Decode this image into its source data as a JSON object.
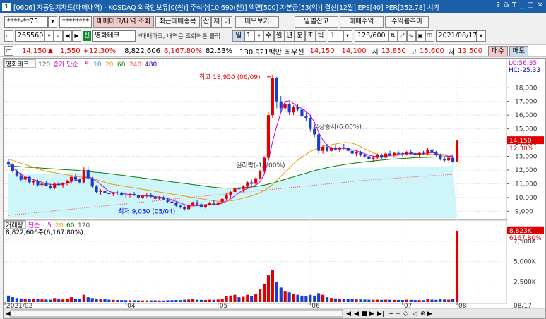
{
  "window": {
    "code": "[0606]",
    "title": "[0606] 자동일지차트(매매내역) - KOSDAQ 외국인보유[0(천)] 주식수[10,690(천)] 액면[500] 자본금[53(억)] 결산[12월] EPS[40] PER[352.78] 시가",
    "controls": [
      "?",
      "□",
      "⊡",
      "▲",
      "T",
      "?",
      "_",
      "□",
      "×"
    ]
  },
  "toolbar1": {
    "account": "****-**75",
    "password": "********",
    "btn_trade_mark": "매매마크/내역 조회",
    "btn_recent": "최근매매종목",
    "btn_balance_1": "잔",
    "btn_balance_2": "체",
    "btn_balance_3": "미",
    "btn_memo": "메모보기",
    "btn_daily": "일별잔고",
    "btn_profit": "매매수익",
    "btn_trend": "수익률추이"
  },
  "toolbar2": {
    "stock_code": "265560",
    "badge": "신",
    "stock_name": "영화테크",
    "hint": "*매매마크, 내역은 조회버튼 클릭",
    "period_buttons": [
      "일",
      "1",
      "주",
      "월",
      "년",
      "분",
      "초",
      "틱"
    ],
    "count_value": "1",
    "range": "123/600",
    "date": "2021/08/17"
  },
  "quote": {
    "price": "14,150",
    "change": "1,550",
    "change_pct": "+12.30%",
    "volume": "8,822,606",
    "volume_pct": "6,167.80%",
    "ratio": "82.53%",
    "amount": "130,921백만",
    "best_label": "최우선",
    "best_ask": "14,150",
    "best_bid": "14,100",
    "open_label": "시",
    "open": "13,850",
    "high_label": "고",
    "high": "15,600",
    "low_label": "저",
    "low": "13,500",
    "buy_btn": "매수",
    "sell_btn": "매도"
  },
  "price_panel": {
    "tab": "영화테크",
    "ma_header": "120",
    "ma_labels": [
      "종가 단순",
      "5",
      "10",
      "20",
      "60",
      "240",
      "480"
    ],
    "lc": "LC:56.35",
    "hc": "HC:-25.33",
    "annot_high": "최고 18,950 (06/09)",
    "annot_low": "최저 9,050 (05/04)",
    "annot_rights": "권리락(-15.00%)",
    "annot_bonus": "무상증자(6.00%)",
    "price_tag": "14,150",
    "pct_tag": "12.30%"
  },
  "volume_panel": {
    "label": "거래량",
    "ma_labels": [
      "단순",
      "5",
      "20",
      "60",
      "120"
    ],
    "value_text": "8,822,606주(6,167.80%)",
    "vol_tag": "8,823K",
    "pct_tag": "6167.80%",
    "date_end": "08/17"
  },
  "chart_data": {
    "type": "candlestick",
    "price_axis": [
      "18,000",
      "17,000",
      "16,000",
      "15,000",
      "14,000",
      "13,000",
      "12,000",
      "11,000",
      "10,000",
      "9,000"
    ],
    "price_range": [
      8500,
      19300
    ],
    "volume_axis": [
      "7,500K",
      "5,000K",
      "2,500K"
    ],
    "volume_range": [
      0,
      9500
    ],
    "x_labels": [
      "2021/02",
      "04",
      "05",
      "06",
      "07",
      "08"
    ],
    "candles": [
      [
        12600,
        12800,
        12200,
        12400,
        800
      ],
      [
        12400,
        12500,
        11800,
        11900,
        600
      ],
      [
        11900,
        12100,
        11500,
        11600,
        500
      ],
      [
        11600,
        11800,
        11200,
        11300,
        450
      ],
      [
        11300,
        11600,
        11100,
        11500,
        400
      ],
      [
        11500,
        11600,
        11000,
        11100,
        420
      ],
      [
        11100,
        11300,
        10900,
        11200,
        380
      ],
      [
        11200,
        11300,
        10800,
        10900,
        360
      ],
      [
        10900,
        11100,
        10700,
        11000,
        340
      ],
      [
        11000,
        11200,
        10800,
        10850,
        320
      ],
      [
        10850,
        11000,
        10600,
        10700,
        300
      ],
      [
        10700,
        11100,
        10600,
        11000,
        500
      ],
      [
        11000,
        11200,
        10800,
        10900,
        350
      ],
      [
        10900,
        11100,
        10700,
        11050,
        330
      ],
      [
        11050,
        11300,
        10900,
        11200,
        400
      ],
      [
        11200,
        11600,
        11000,
        11500,
        600
      ],
      [
        11500,
        11700,
        11200,
        11300,
        420
      ],
      [
        11300,
        11400,
        11000,
        11100,
        380
      ],
      [
        11100,
        12200,
        11000,
        12000,
        900
      ],
      [
        12000,
        12300,
        11300,
        11400,
        600
      ],
      [
        11400,
        11500,
        10700,
        10800,
        500
      ],
      [
        10800,
        10900,
        10300,
        10400,
        420
      ],
      [
        10400,
        10600,
        10200,
        10500,
        380
      ],
      [
        10500,
        10600,
        10200,
        10300,
        350
      ],
      [
        10300,
        10400,
        10100,
        10250,
        300
      ],
      [
        10250,
        10400,
        10100,
        10350,
        280
      ],
      [
        10350,
        10500,
        10200,
        10300,
        260
      ],
      [
        10300,
        10400,
        10100,
        10200,
        250
      ],
      [
        10200,
        10300,
        10000,
        10150,
        240
      ],
      [
        10150,
        10300,
        10000,
        10250,
        230
      ],
      [
        10250,
        10400,
        10100,
        10150,
        220
      ],
      [
        10150,
        10200,
        9900,
        10000,
        210
      ],
      [
        10000,
        10200,
        9900,
        10100,
        200
      ],
      [
        10100,
        10300,
        10000,
        10200,
        220
      ],
      [
        10200,
        10300,
        10000,
        10050,
        210
      ],
      [
        10050,
        10100,
        9800,
        9900,
        220
      ],
      [
        9900,
        10100,
        9800,
        10000,
        200
      ],
      [
        10000,
        10100,
        9800,
        9850,
        190
      ],
      [
        9850,
        9950,
        9600,
        9700,
        230
      ],
      [
        9700,
        9800,
        9500,
        9600,
        240
      ],
      [
        9600,
        9700,
        9300,
        9400,
        260
      ],
      [
        9400,
        9500,
        9200,
        9300,
        250
      ],
      [
        9300,
        9400,
        9050,
        9150,
        300
      ],
      [
        9150,
        9500,
        9100,
        9450,
        320
      ],
      [
        9450,
        9700,
        9350,
        9650,
        350
      ],
      [
        9650,
        9800,
        9400,
        9500,
        300
      ],
      [
        9500,
        9600,
        9250,
        9300,
        280
      ],
      [
        9300,
        9500,
        9200,
        9450,
        270
      ],
      [
        9450,
        9700,
        9400,
        9600,
        300
      ],
      [
        9600,
        9800,
        9450,
        9500,
        290
      ],
      [
        9500,
        9700,
        9400,
        9650,
        320
      ],
      [
        9650,
        10000,
        9600,
        9900,
        400
      ],
      [
        9900,
        10300,
        9800,
        10200,
        700
      ],
      [
        10200,
        10500,
        10000,
        10400,
        800
      ],
      [
        10400,
        10800,
        10300,
        10700,
        900
      ],
      [
        10700,
        11000,
        10500,
        10600,
        600
      ],
      [
        10600,
        10900,
        10400,
        10800,
        650
      ],
      [
        10800,
        11200,
        10700,
        11100,
        900
      ],
      [
        11100,
        11300,
        10900,
        11000,
        700
      ],
      [
        11000,
        11500,
        10900,
        11400,
        1000
      ],
      [
        11400,
        12000,
        11300,
        11900,
        1600
      ],
      [
        11900,
        13000,
        11800,
        12900,
        2200
      ],
      [
        12900,
        16200,
        12700,
        16000,
        3300
      ],
      [
        16000,
        18950,
        15800,
        18700,
        4000
      ],
      [
        18700,
        18800,
        16500,
        17000,
        2500
      ],
      [
        17000,
        17400,
        16200,
        16500,
        1800
      ],
      [
        16500,
        17000,
        16200,
        16800,
        1300
      ],
      [
        16800,
        16900,
        16000,
        16200,
        1200
      ],
      [
        16200,
        16700,
        16000,
        16600,
        1000
      ],
      [
        16600,
        16800,
        16300,
        16400,
        900
      ],
      [
        16400,
        16500,
        15800,
        15900,
        800
      ],
      [
        15900,
        16200,
        15600,
        15800,
        700
      ],
      [
        15800,
        16000,
        14800,
        15000,
        900
      ],
      [
        15000,
        15300,
        14400,
        14600,
        800
      ],
      [
        14600,
        14800,
        13200,
        13400,
        1100
      ],
      [
        13400,
        13800,
        13200,
        13700,
        900
      ],
      [
        13700,
        13900,
        13300,
        13400,
        600
      ],
      [
        13400,
        13700,
        13300,
        13600,
        500
      ],
      [
        13600,
        13800,
        13400,
        13500,
        450
      ],
      [
        13500,
        13700,
        13300,
        13650,
        420
      ],
      [
        13650,
        13900,
        13500,
        13600,
        400
      ],
      [
        13600,
        13700,
        13300,
        13400,
        380
      ],
      [
        13400,
        13500,
        13100,
        13200,
        360
      ],
      [
        13200,
        13400,
        13000,
        13300,
        340
      ],
      [
        13300,
        13400,
        13000,
        13100,
        330
      ],
      [
        13100,
        13200,
        12900,
        13000,
        320
      ],
      [
        13000,
        13100,
        12700,
        12800,
        300
      ],
      [
        12800,
        13000,
        12600,
        12900,
        290
      ],
      [
        12900,
        13200,
        12800,
        13100,
        300
      ],
      [
        13100,
        13200,
        12800,
        12900,
        280
      ],
      [
        12900,
        13300,
        12850,
        13200,
        300
      ],
      [
        13200,
        13400,
        13000,
        13100,
        290
      ],
      [
        13100,
        13300,
        12900,
        13250,
        280
      ],
      [
        13250,
        13400,
        13100,
        13200,
        270
      ],
      [
        13200,
        13300,
        13000,
        13150,
        260
      ],
      [
        13150,
        13400,
        13050,
        13300,
        300
      ],
      [
        13300,
        13500,
        13100,
        13200,
        280
      ],
      [
        13200,
        13300,
        13000,
        13100,
        260
      ],
      [
        13100,
        13300,
        12900,
        13250,
        250
      ],
      [
        13250,
        13400,
        13100,
        13200,
        240
      ],
      [
        13200,
        13600,
        13100,
        13500,
        400
      ],
      [
        13500,
        13600,
        13200,
        13300,
        300
      ],
      [
        13300,
        13400,
        13000,
        13100,
        280
      ],
      [
        13100,
        13200,
        12700,
        12800,
        350
      ],
      [
        12800,
        13000,
        12600,
        12700,
        320
      ],
      [
        12700,
        13000,
        12600,
        12900,
        300
      ],
      [
        12900,
        13000,
        12500,
        12600,
        380
      ],
      [
        12600,
        13900,
        13500,
        14150,
        8823
      ]
    ],
    "ma5": [
      12500,
      12200,
      11900,
      11700,
      11500,
      11400,
      11300,
      11200,
      11100,
      11000,
      10950,
      10950,
      10950,
      11000,
      11050,
      11150,
      11250,
      11300,
      11450,
      11500,
      11400,
      11200,
      10950,
      10700,
      10450,
      10350,
      10350,
      10300,
      10250,
      10220,
      10200,
      10150,
      10120,
      10110,
      10110,
      10070,
      10030,
      9990,
      9920,
      9800,
      9720,
      9600,
      9480,
      9400,
      9380,
      9400,
      9420,
      9480,
      9480,
      9500,
      9500,
      9570,
      9740,
      9900,
      10120,
      10350,
      10530,
      10640,
      10780,
      10890,
      11140,
      11680,
      12680,
      14080,
      15200,
      16220,
      17000,
      17040,
      16840,
      16600,
      16500,
      16260,
      16000,
      15480,
      14740,
      14180,
      13820,
      13580,
      13580,
      13580,
      13580,
      13530,
      13470,
      13410,
      13290,
      13190,
      13090,
      13010,
      12980,
      12960,
      12980,
      13060,
      13130,
      13160,
      13200,
      13210,
      13220,
      13210,
      13170,
      13190,
      13240,
      13270,
      13230,
      13080,
      13100,
      13000,
      13050
    ],
    "ma20": [
      12800,
      12700,
      12600,
      12500,
      12400,
      12300,
      12200,
      12100,
      12000,
      11900,
      11850,
      11800,
      11750,
      11700,
      11650,
      11600,
      11550,
      11500,
      11480,
      11450,
      11400,
      11300,
      11200,
      11100,
      11000,
      10950,
      10900,
      10850,
      10800,
      10750,
      10700,
      10650,
      10600,
      10550,
      10500,
      10450,
      10400,
      10350,
      10300,
      10250,
      10200,
      10150,
      10100,
      10050,
      10000,
      9950,
      9900,
      9850,
      9800,
      9760,
      9730,
      9720,
      9730,
      9760,
      9800,
      9870,
      9950,
      10030,
      10120,
      10220,
      10350,
      10500,
      10700,
      10950,
      11250,
      11550,
      11850,
      12150,
      12450,
      12700,
      12950,
      13150,
      13350,
      13500,
      13600,
      13700,
      13800,
      13850,
      13900,
      13950,
      14000,
      14000,
      13950,
      13850,
      13700,
      13550,
      13400,
      13250,
      13150,
      13080,
      13050,
      13050,
      13060,
      13080,
      13100,
      13120,
      13140,
      13150,
      13150,
      13150,
      13150,
      13150,
      13150,
      13140,
      13130,
      13100,
      13100
    ],
    "ma60": [
      12300,
      12280,
      12260,
      12240,
      12220,
      12200,
      12180,
      12160,
      12140,
      12120,
      12100,
      12080,
      12060,
      12040,
      12020,
      12000,
      11980,
      11950,
      11920,
      11890,
      11860,
      11830,
      11800,
      11770,
      11740,
      11700,
      11660,
      11620,
      11580,
      11540,
      11500,
      11460,
      11420,
      11380,
      11340,
      11300,
      11260,
      11220,
      11180,
      11140,
      11100,
      11060,
      11020,
      10980,
      10940,
      10900,
      10860,
      10820,
      10780,
      10740,
      10710,
      10690,
      10680,
      10680,
      10690,
      10700,
      10720,
      10740,
      10770,
      10800,
      10850,
      10900,
      10970,
      11050,
      11140,
      11230,
      11320,
      11410,
      11500,
      11590,
      11680,
      11770,
      11860,
      11950,
      12030,
      12100,
      12170,
      12230,
      12290,
      12340,
      12390,
      12440,
      12480,
      12520,
      12560,
      12600,
      12630,
      12660,
      12690,
      12720,
      12750,
      12780,
      12800,
      12820,
      12840,
      12860,
      12880,
      12900,
      12910,
      12920,
      12930,
      12940,
      12950,
      12960,
      12970,
      12980,
      12990
    ],
    "ma120_baseline": 11700,
    "ma240": [
      8700,
      8730,
      8760,
      8790,
      8820,
      8850,
      8880,
      8910,
      8940,
      8970,
      9000,
      9030,
      9060,
      9090,
      9120,
      9150,
      9180,
      9210,
      9240,
      9270,
      9300,
      9330,
      9360,
      9390,
      9420,
      9450,
      9480,
      9510,
      9540,
      9570,
      9600,
      9630,
      9660,
      9690,
      9720,
      9750,
      9780,
      9810,
      9840,
      9870,
      9900,
      9930,
      9960,
      9990,
      10020,
      10050,
      10080,
      10110,
      10140,
      10170,
      10200,
      10230,
      10260,
      10290,
      10320,
      10350,
      10380,
      10410,
      10440,
      10470,
      10500,
      10530,
      10560,
      10590,
      10620,
      10650,
      10680,
      10710,
      10740,
      10770,
      10800,
      10830,
      10860,
      10890,
      10920,
      10950,
      10980,
      11010,
      11040,
      11070,
      11100,
      11130,
      11160,
      11190,
      11220,
      11250,
      11280,
      11300,
      11320,
      11340,
      11360,
      11380,
      11400,
      11420,
      11440,
      11460,
      11480,
      11500,
      11520,
      11540,
      11560,
      11580,
      11600,
      11620,
      11640,
      11660,
      11680
    ]
  },
  "colors": {
    "up": "#e00000",
    "down": "#1a3ccf",
    "ma5": "#d000d0",
    "ma10": "#0080ff",
    "ma20": "#e8a000",
    "ma60": "#008000",
    "ma240": "#ff4040",
    "fill": "#cdf5fa"
  }
}
